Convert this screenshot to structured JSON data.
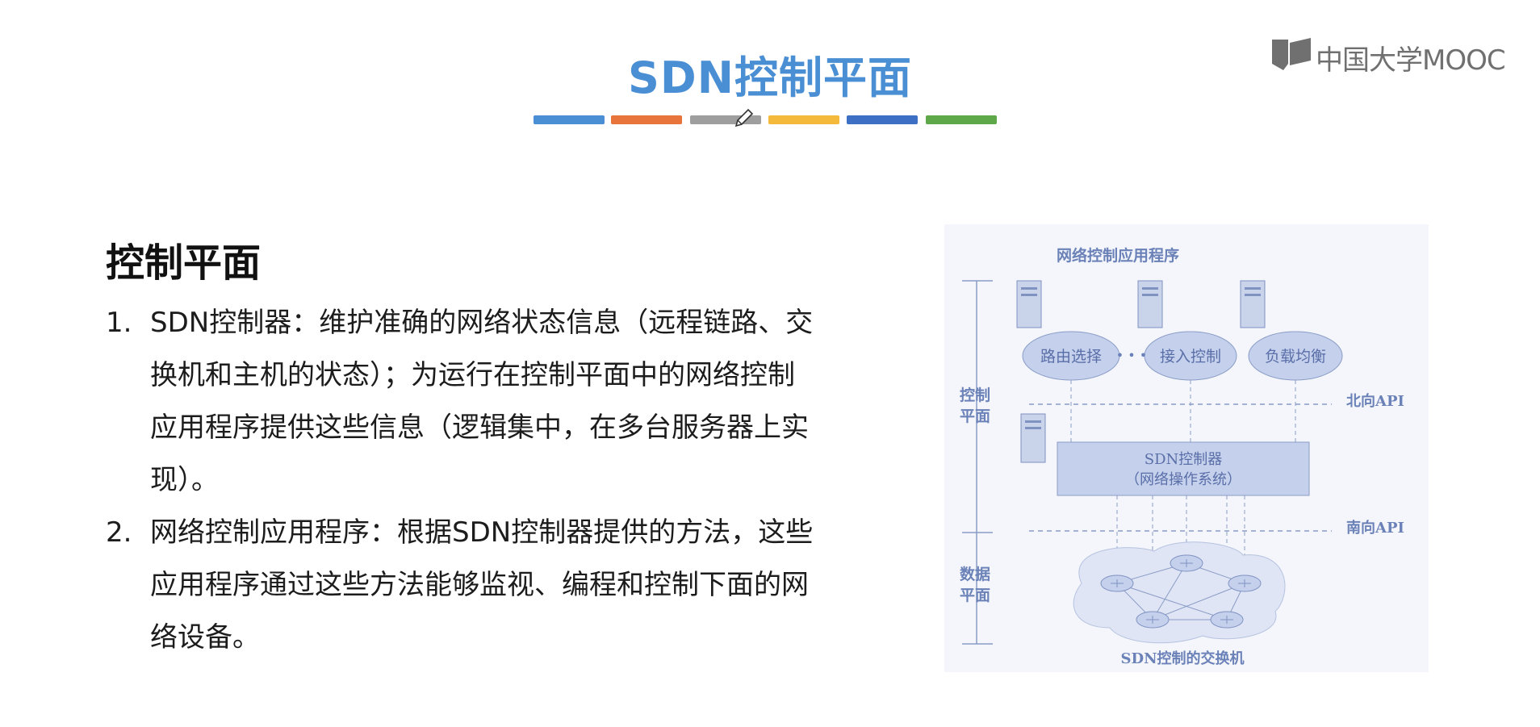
{
  "slide": {
    "title": "SDN控制平面",
    "color_bars": [
      "#4a8fd4",
      "#e8743b",
      "#9e9e9e",
      "#f4b93a",
      "#3d6fc4",
      "#5fa84a"
    ]
  },
  "logo": {
    "text": "中国大学MOOC"
  },
  "section": {
    "heading": "控制平面",
    "points": [
      {
        "number": "1.",
        "lines": [
          "SDN控制器：维护准确的网络状态信息（远程链路、交",
          "换机和主机的状态）；为运行在控制平面中的网络控制",
          "应用程序提供这些信息（逻辑集中，在多台服务器上实",
          "现）。"
        ]
      },
      {
        "number": "2.",
        "lines": [
          "网络控制应用程序：根据SDN控制器提供的方法，这些",
          "应用程序通过这些方法能够监视、编程和控制下面的网",
          "络设备。"
        ]
      }
    ]
  },
  "diagram": {
    "top_label": "网络控制应用程序",
    "apps": [
      "路由选择",
      "接入控制",
      "负载均衡"
    ],
    "dots": "• • •",
    "control_plane_label": [
      "控制",
      "平面"
    ],
    "data_plane_label": [
      "数据",
      "平面"
    ],
    "northbound": "北向API",
    "southbound": "南向API",
    "controller": [
      "SDN控制器",
      "（网络操作系统）"
    ],
    "switches_label": "SDN控制的交换机"
  }
}
